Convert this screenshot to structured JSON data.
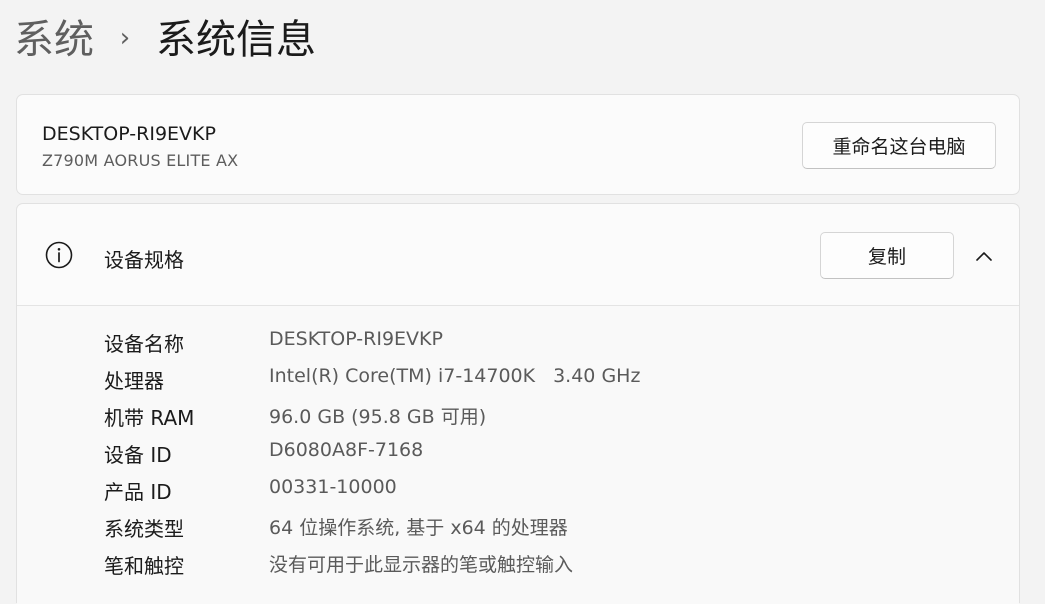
{
  "breadcrumb": {
    "parent": "系统",
    "separator": "›",
    "current": "系统信息"
  },
  "device": {
    "name": "DESKTOP-RI9EVKP",
    "model": "Z790M AORUS ELITE AX",
    "rename_button": "重命名这台电脑"
  },
  "specs": {
    "title": "设备规格",
    "icon": "info-icon",
    "copy_button": "复制",
    "collapse_icon": "chevron-up-icon",
    "rows": [
      {
        "label": "设备名称",
        "value": "DESKTOP-RI9EVKP"
      },
      {
        "label": "处理器",
        "value": "Intel(R) Core(TM) i7-14700K",
        "value2": "3.40 GHz"
      },
      {
        "label": "机带 RAM",
        "value": "96.0 GB (95.8 GB 可用)"
      },
      {
        "label": "设备 ID",
        "value": "D6080A8F-7168"
      },
      {
        "label": "产品 ID",
        "value": "00331-10000"
      },
      {
        "label": "系统类型",
        "value": "64 位操作系统, 基于 x64 的处理器"
      },
      {
        "label": "笔和触控",
        "value": "没有可用于此显示器的笔或触控输入"
      }
    ]
  },
  "colors": {
    "background": "#f3f3f3",
    "card": "#fbfbfb",
    "text_primary": "#1b1b1b",
    "text_secondary": "#5a5a5a"
  }
}
